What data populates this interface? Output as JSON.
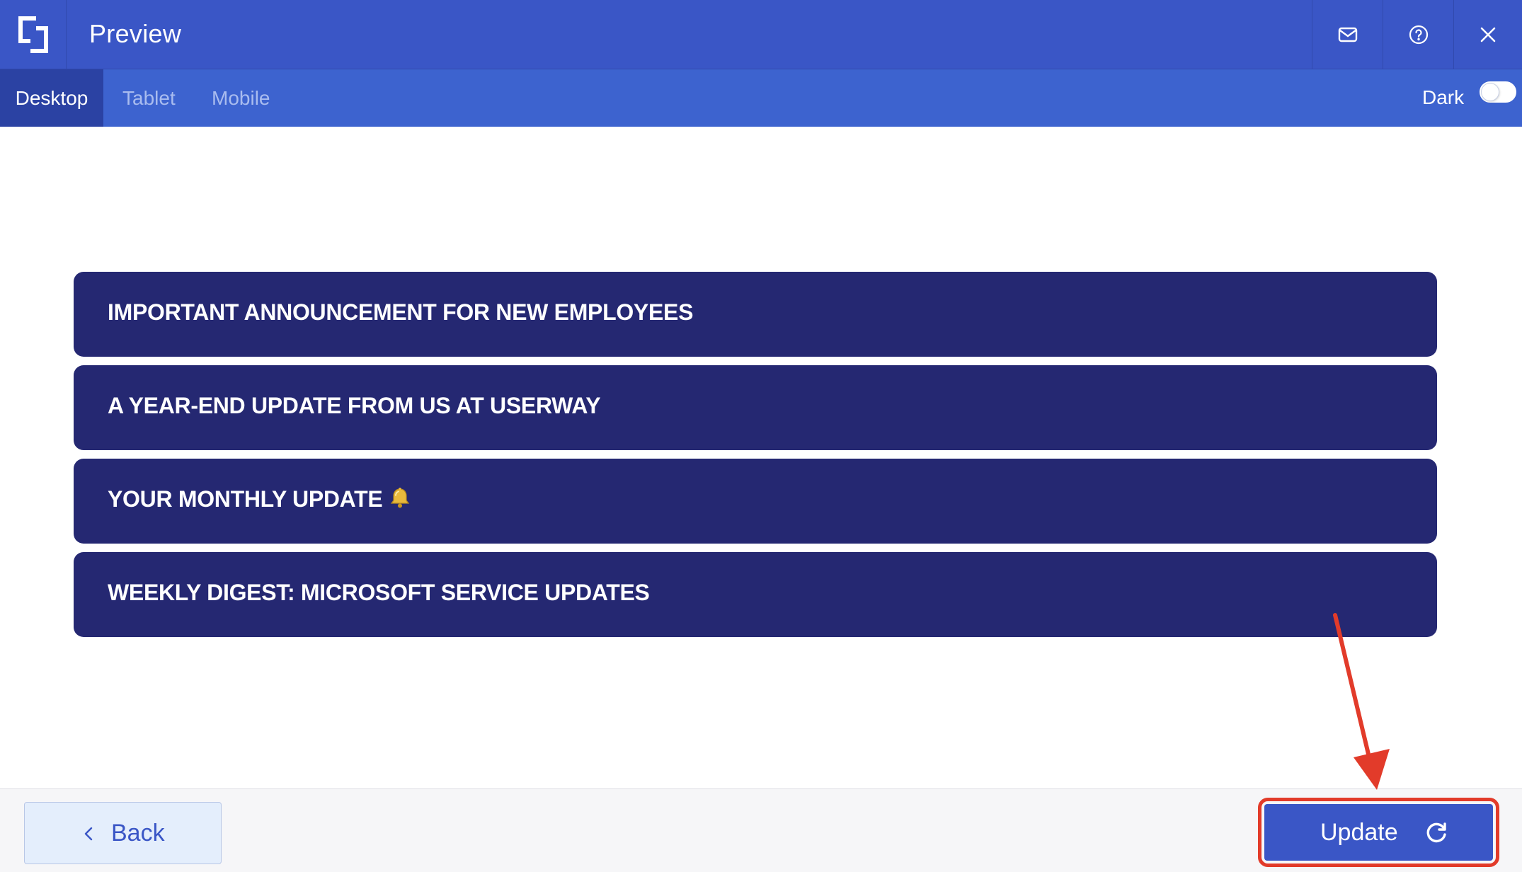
{
  "header": {
    "title": "Preview",
    "icons": {
      "logo": "brand-logo",
      "mail": "mail-icon",
      "help": "help-circle-icon",
      "close": "close-icon"
    }
  },
  "tabs": {
    "items": [
      {
        "label": "Desktop",
        "active": true
      },
      {
        "label": "Tablet",
        "active": false
      },
      {
        "label": "Mobile",
        "active": false
      }
    ],
    "dark_label": "Dark",
    "dark_enabled": false
  },
  "banners": [
    {
      "text": "IMPORTANT ANNOUNCEMENT FOR NEW EMPLOYEES"
    },
    {
      "text": "A YEAR-END UPDATE FROM US AT USERWAY"
    },
    {
      "text": "YOUR MONTHLY UPDATE",
      "icon": "bell-icon"
    },
    {
      "text": "WEEKLY DIGEST: MICROSOFT SERVICE UPDATES"
    }
  ],
  "footer": {
    "back_label": "Back",
    "update_label": "Update"
  },
  "colors": {
    "header_bg": "#3a56c6",
    "tab_bar_bg": "#3d63cf",
    "tab_active_bg": "#2b42a3",
    "banner_bg": "#252872",
    "annotation_red": "#e23b2a",
    "back_button_bg": "#e4eefc"
  }
}
